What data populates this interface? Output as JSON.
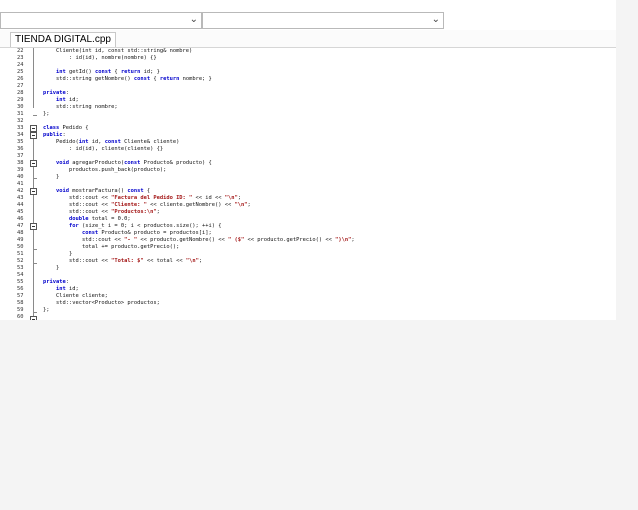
{
  "window": {
    "file_tab": "TIENDA DIGITAL.cpp"
  },
  "toolbar": {
    "scope_combo_value": "",
    "symbol_combo_value": ""
  },
  "editor": {
    "lines": [
      {
        "n": "22",
        "segs": [
          [
            "    ",
            ""
          ],
          [
            "Cliente(int id, const std::string& nombre)",
            ""
          ]
        ]
      },
      {
        "n": "23",
        "segs": [
          [
            "        : id(id), nombre(nombre) {}",
            ""
          ]
        ]
      },
      {
        "n": "24",
        "segs": [
          [
            "",
            ""
          ]
        ]
      },
      {
        "n": "25",
        "segs": [
          [
            "    ",
            ""
          ],
          [
            "int",
            "kw"
          ],
          [
            " getId() ",
            ""
          ],
          [
            "const",
            "kw"
          ],
          [
            " { ",
            ""
          ],
          [
            "return",
            "kw"
          ],
          [
            " id; }",
            ""
          ]
        ]
      },
      {
        "n": "26",
        "segs": [
          [
            "    std::string getNombre() ",
            ""
          ],
          [
            "const",
            "kw"
          ],
          [
            " { ",
            ""
          ],
          [
            "return",
            "kw"
          ],
          [
            " nombre; }",
            ""
          ]
        ]
      },
      {
        "n": "27",
        "segs": [
          [
            "",
            ""
          ]
        ]
      },
      {
        "n": "28",
        "segs": [
          [
            "private",
            "kw"
          ],
          [
            ":",
            ""
          ]
        ]
      },
      {
        "n": "29",
        "segs": [
          [
            "    ",
            ""
          ],
          [
            "int",
            "kw"
          ],
          [
            " id;",
            ""
          ]
        ]
      },
      {
        "n": "30",
        "segs": [
          [
            "    std::string nombre;",
            ""
          ]
        ]
      },
      {
        "n": "31",
        "segs": [
          [
            "};",
            ""
          ]
        ]
      },
      {
        "n": "32",
        "segs": [
          [
            "",
            ""
          ]
        ]
      },
      {
        "n": "33",
        "segs": [
          [
            "class",
            "kw"
          ],
          [
            " Pedido {",
            ""
          ]
        ]
      },
      {
        "n": "34",
        "segs": [
          [
            "public",
            "kw"
          ],
          [
            ":",
            ""
          ]
        ]
      },
      {
        "n": "35",
        "segs": [
          [
            "    Pedido(",
            ""
          ],
          [
            "int",
            "kw"
          ],
          [
            " id, ",
            ""
          ],
          [
            "const",
            "kw"
          ],
          [
            " Cliente& cliente)",
            ""
          ]
        ]
      },
      {
        "n": "36",
        "segs": [
          [
            "        : id(id), cliente(cliente) {}",
            ""
          ]
        ]
      },
      {
        "n": "37",
        "segs": [
          [
            "",
            ""
          ]
        ]
      },
      {
        "n": "38",
        "segs": [
          [
            "    ",
            ""
          ],
          [
            "void",
            "kw"
          ],
          [
            " agregarProducto(",
            ""
          ],
          [
            "const",
            "kw"
          ],
          [
            " Producto& producto) {",
            ""
          ]
        ]
      },
      {
        "n": "39",
        "segs": [
          [
            "        productos.push_back(producto);",
            ""
          ]
        ]
      },
      {
        "n": "40",
        "segs": [
          [
            "    }",
            ""
          ]
        ]
      },
      {
        "n": "41",
        "segs": [
          [
            "",
            ""
          ]
        ]
      },
      {
        "n": "42",
        "segs": [
          [
            "    ",
            ""
          ],
          [
            "void",
            "kw"
          ],
          [
            " mostrarFactura() ",
            ""
          ],
          [
            "const",
            "kw"
          ],
          [
            " {",
            ""
          ]
        ]
      },
      {
        "n": "43",
        "segs": [
          [
            "        std::cout << ",
            ""
          ],
          [
            "\"Factura del Pedido ID: \"",
            "str"
          ],
          [
            " << id << ",
            ""
          ],
          [
            "\"\\n\"",
            "str"
          ],
          [
            ";",
            ""
          ]
        ]
      },
      {
        "n": "44",
        "segs": [
          [
            "        std::cout << ",
            ""
          ],
          [
            "\"Cliente: \"",
            "str"
          ],
          [
            " << cliente.getNombre() << ",
            ""
          ],
          [
            "\"\\n\"",
            "str"
          ],
          [
            ";",
            ""
          ]
        ]
      },
      {
        "n": "45",
        "segs": [
          [
            "        std::cout << ",
            ""
          ],
          [
            "\"Productos:\\n\"",
            "str"
          ],
          [
            ";",
            ""
          ]
        ]
      },
      {
        "n": "46",
        "segs": [
          [
            "        ",
            ""
          ],
          [
            "double",
            "kw"
          ],
          [
            " total = 0.0;",
            ""
          ]
        ]
      },
      {
        "n": "47",
        "segs": [
          [
            "        ",
            ""
          ],
          [
            "for",
            "kw"
          ],
          [
            " (size_t i = 0; i < productos.size(); ++i) {",
            ""
          ]
        ]
      },
      {
        "n": "48",
        "segs": [
          [
            "            ",
            ""
          ],
          [
            "const",
            "kw"
          ],
          [
            " Producto& producto = productos[i];",
            ""
          ]
        ]
      },
      {
        "n": "49",
        "segs": [
          [
            "            std::cout << ",
            ""
          ],
          [
            "\"- \"",
            "str"
          ],
          [
            " << producto.getNombre() << ",
            ""
          ],
          [
            "\" ($\"",
            "str"
          ],
          [
            " << producto.getPrecio() << ",
            ""
          ],
          [
            "\")\\n\"",
            "str"
          ],
          [
            ";",
            ""
          ]
        ]
      },
      {
        "n": "50",
        "segs": [
          [
            "            total += producto.getPrecio();",
            ""
          ]
        ]
      },
      {
        "n": "51",
        "segs": [
          [
            "        }",
            ""
          ]
        ]
      },
      {
        "n": "52",
        "segs": [
          [
            "        std::cout << ",
            ""
          ],
          [
            "\"Total: $\"",
            "str"
          ],
          [
            " << total << ",
            ""
          ],
          [
            "\"\\n\"",
            "str"
          ],
          [
            ";",
            ""
          ]
        ]
      },
      {
        "n": "53",
        "segs": [
          [
            "    }",
            ""
          ]
        ]
      },
      {
        "n": "54",
        "segs": [
          [
            "",
            ""
          ]
        ]
      },
      {
        "n": "55",
        "segs": [
          [
            "private",
            "kw"
          ],
          [
            ":",
            ""
          ]
        ]
      },
      {
        "n": "56",
        "segs": [
          [
            "    ",
            ""
          ],
          [
            "int",
            "kw"
          ],
          [
            " id;",
            ""
          ]
        ]
      },
      {
        "n": "57",
        "segs": [
          [
            "    Cliente cliente;",
            ""
          ]
        ]
      },
      {
        "n": "58",
        "segs": [
          [
            "    std::vector<Producto> productos;",
            ""
          ]
        ]
      },
      {
        "n": "59",
        "segs": [
          [
            "};",
            ""
          ]
        ]
      },
      {
        "n": "60",
        "segs": [
          [
            "",
            ""
          ]
        ]
      }
    ]
  }
}
